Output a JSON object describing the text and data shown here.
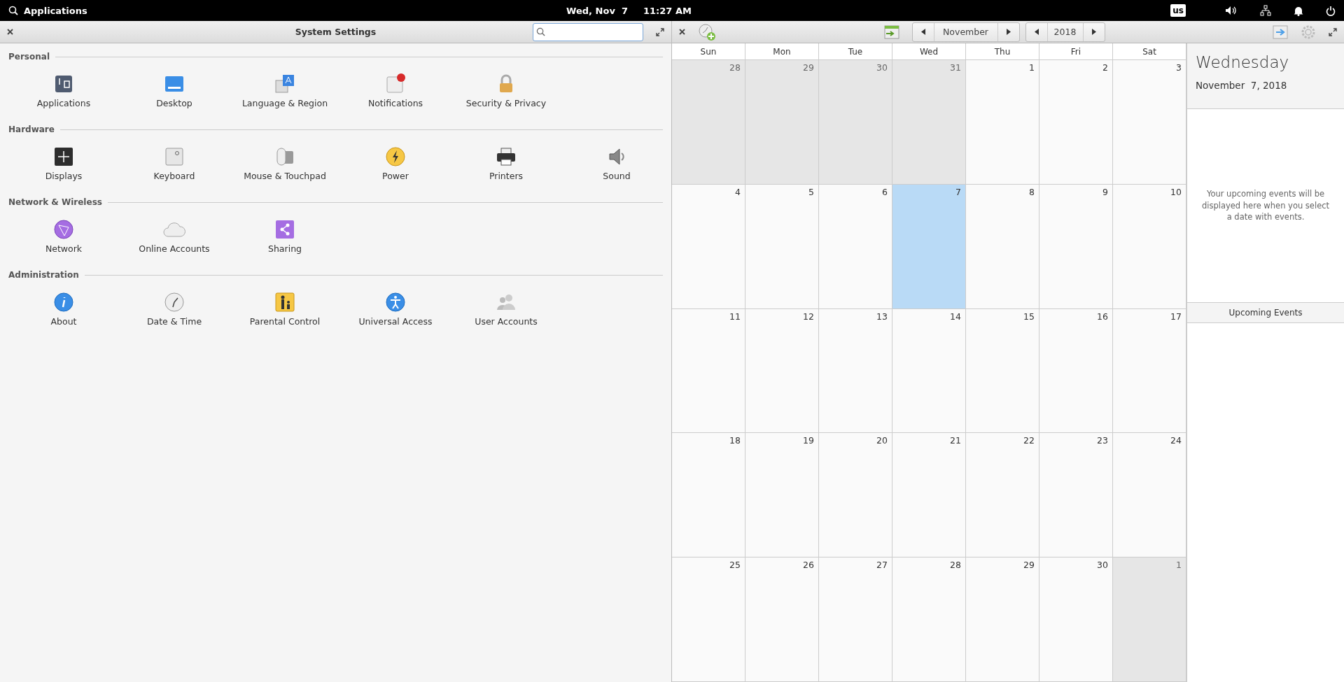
{
  "top_panel": {
    "menu_label": "Applications",
    "date": "Wed, Nov  7",
    "time": "11:27 AM",
    "keyboard_layout": "us"
  },
  "settings": {
    "title": "System Settings",
    "sections": [
      {
        "title": "Personal",
        "items": [
          "Applications",
          "Desktop",
          "Language & Region",
          "Notifications",
          "Security & Privacy"
        ]
      },
      {
        "title": "Hardware",
        "items": [
          "Displays",
          "Keyboard",
          "Mouse & Touchpad",
          "Power",
          "Printers",
          "Sound"
        ]
      },
      {
        "title": "Network & Wireless",
        "items": [
          "Network",
          "Online Accounts",
          "Sharing"
        ]
      },
      {
        "title": "Administration",
        "items": [
          "About",
          "Date & Time",
          "Parental Control",
          "Universal Access",
          "User Accounts"
        ]
      }
    ]
  },
  "calendar": {
    "month": "November",
    "year": "2018",
    "weekdays": [
      "Sun",
      "Mon",
      "Tue",
      "Wed",
      "Thu",
      "Fri",
      "Sat"
    ],
    "weeks": [
      [
        {
          "day": "28",
          "in_month": false,
          "selected": false
        },
        {
          "day": "29",
          "in_month": false,
          "selected": false
        },
        {
          "day": "30",
          "in_month": false,
          "selected": false
        },
        {
          "day": "31",
          "in_month": false,
          "selected": false
        },
        {
          "day": "1",
          "in_month": true,
          "selected": false
        },
        {
          "day": "2",
          "in_month": true,
          "selected": false
        },
        {
          "day": "3",
          "in_month": true,
          "selected": false
        }
      ],
      [
        {
          "day": "4",
          "in_month": true,
          "selected": false
        },
        {
          "day": "5",
          "in_month": true,
          "selected": false
        },
        {
          "day": "6",
          "in_month": true,
          "selected": false
        },
        {
          "day": "7",
          "in_month": true,
          "selected": true
        },
        {
          "day": "8",
          "in_month": true,
          "selected": false
        },
        {
          "day": "9",
          "in_month": true,
          "selected": false
        },
        {
          "day": "10",
          "in_month": true,
          "selected": false
        }
      ],
      [
        {
          "day": "11",
          "in_month": true,
          "selected": false
        },
        {
          "day": "12",
          "in_month": true,
          "selected": false
        },
        {
          "day": "13",
          "in_month": true,
          "selected": false
        },
        {
          "day": "14",
          "in_month": true,
          "selected": false
        },
        {
          "day": "15",
          "in_month": true,
          "selected": false
        },
        {
          "day": "16",
          "in_month": true,
          "selected": false
        },
        {
          "day": "17",
          "in_month": true,
          "selected": false
        }
      ],
      [
        {
          "day": "18",
          "in_month": true,
          "selected": false
        },
        {
          "day": "19",
          "in_month": true,
          "selected": false
        },
        {
          "day": "20",
          "in_month": true,
          "selected": false
        },
        {
          "day": "21",
          "in_month": true,
          "selected": false
        },
        {
          "day": "22",
          "in_month": true,
          "selected": false
        },
        {
          "day": "23",
          "in_month": true,
          "selected": false
        },
        {
          "day": "24",
          "in_month": true,
          "selected": false
        }
      ],
      [
        {
          "day": "25",
          "in_month": true,
          "selected": false
        },
        {
          "day": "26",
          "in_month": true,
          "selected": false
        },
        {
          "day": "27",
          "in_month": true,
          "selected": false
        },
        {
          "day": "28",
          "in_month": true,
          "selected": false
        },
        {
          "day": "29",
          "in_month": true,
          "selected": false
        },
        {
          "day": "30",
          "in_month": true,
          "selected": false
        },
        {
          "day": "1",
          "in_month": false,
          "selected": false
        }
      ]
    ],
    "sidebar": {
      "weekday": "Wednesday",
      "date": "November  7, 2018",
      "empty_message": "Your upcoming events will be displayed here when you select a date with events.",
      "upcoming_label": "Upcoming Events"
    }
  }
}
